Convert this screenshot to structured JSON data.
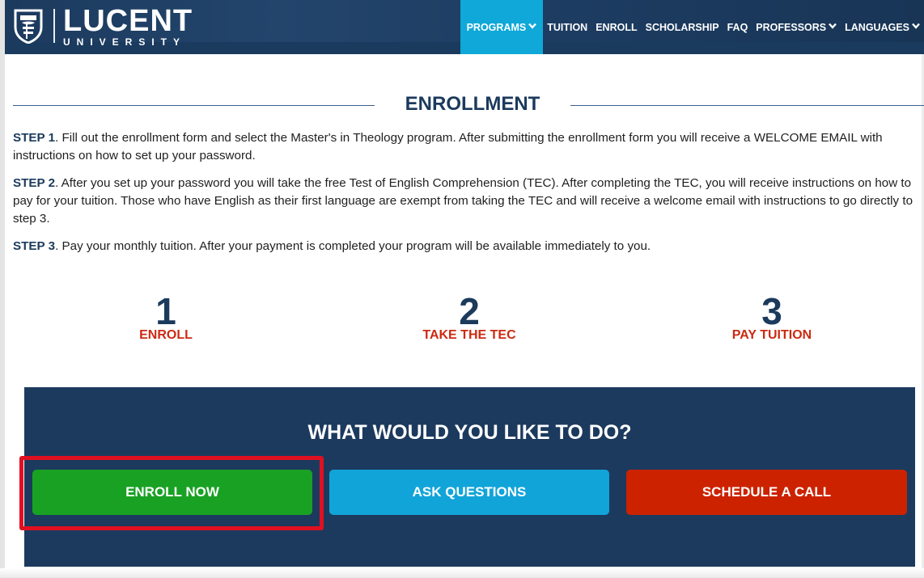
{
  "brand": {
    "title": "LUCENT",
    "subtitle": "UNIVERSITY",
    "logo_icon": "shield-crest-icon"
  },
  "nav": {
    "items": [
      {
        "label": "PROGRAMS",
        "has_dropdown": true,
        "active": true
      },
      {
        "label": "TUITION",
        "has_dropdown": false,
        "active": false
      },
      {
        "label": "ENROLL",
        "has_dropdown": false,
        "active": false
      },
      {
        "label": "SCHOLARSHIP",
        "has_dropdown": false,
        "active": false
      },
      {
        "label": "FAQ",
        "has_dropdown": false,
        "active": false
      },
      {
        "label": "PROFESSORS",
        "has_dropdown": true,
        "active": false
      },
      {
        "label": "LANGUAGES",
        "has_dropdown": true,
        "active": false
      }
    ],
    "dropdown_icon": "chevron-down-icon"
  },
  "enrollment": {
    "title": "ENROLLMENT",
    "steps": [
      {
        "label": "STEP 1",
        "text": ". Fill out the enrollment form and select the Master's in Theology program. After submitting the enrollment form you will receive a WELCOME EMAIL with instructions on how to set up your password."
      },
      {
        "label": "STEP 2",
        "text": ". After you set up your password you will take the free Test of English Comprehension (TEC). After completing the TEC, you will receive instructions on how to pay for your tuition. Those who have English as their first language are exempt from taking the TEC and will receive a welcome email with instructions to go directly to step 3."
      },
      {
        "label": "STEP 3",
        "text": ". Pay your monthly tuition. After your payment is completed your program will be available immediately to you."
      }
    ],
    "big_steps": [
      {
        "number": "1",
        "label": "ENROLL"
      },
      {
        "number": "2",
        "label": "TAKE THE TEC"
      },
      {
        "number": "3",
        "label": "PAY TUITION"
      }
    ]
  },
  "cta": {
    "title": "WHAT WOULD YOU LIKE TO DO?",
    "enroll_label": "ENROLL NOW",
    "ask_label": "ASK QUESTIONS",
    "call_label": "SCHEDULE A CALL"
  },
  "colors": {
    "header_bg": "#1c3a5e",
    "nav_active": "#0fa8d8",
    "accent_red": "#cc2a12",
    "enroll_green": "#19a124",
    "ask_blue": "#11a4d9",
    "call_red": "#cc2200",
    "highlight": "#e01020"
  }
}
